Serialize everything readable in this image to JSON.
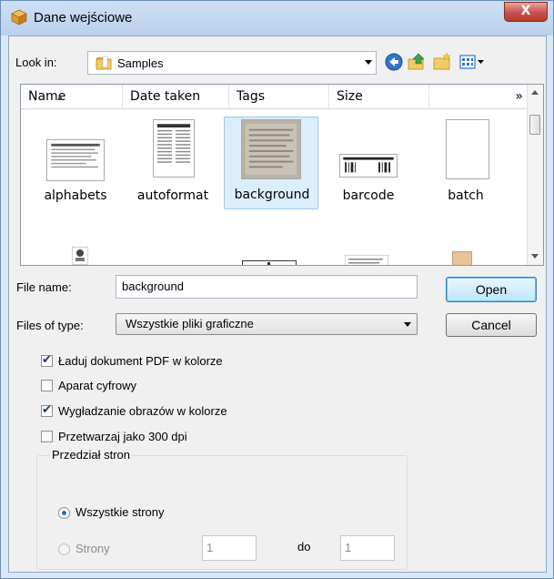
{
  "window": {
    "title": "Dane wejściowe",
    "close_glyph": "X"
  },
  "toolbar": {
    "look_in_label": "Look in:",
    "look_in_value": "Samples",
    "icons": [
      "back-icon",
      "up-folder-icon",
      "new-folder-icon",
      "view-menu-icon"
    ]
  },
  "columns": [
    "Name",
    "Date taken",
    "Tags",
    "Size",
    "»"
  ],
  "files": [
    {
      "name": "alphabets",
      "selected": false
    },
    {
      "name": "autoformat",
      "selected": false
    },
    {
      "name": "background",
      "selected": true
    },
    {
      "name": "barcode",
      "selected": false
    },
    {
      "name": "batch",
      "selected": false
    }
  ],
  "form": {
    "file_name_label": "File name:",
    "file_name_value": "background",
    "files_of_type_label": "Files of type:",
    "files_of_type_value": "Wszystkie pliki graficzne",
    "open_label": "Open",
    "cancel_label": "Cancel"
  },
  "options": [
    {
      "label": "Ładuj dokument PDF w kolorze",
      "checked": true
    },
    {
      "label": "Aparat cyfrowy",
      "checked": false
    },
    {
      "label": "Wygładzanie obrazów w kolorze",
      "checked": true
    },
    {
      "label": "Przetwarzaj jako 300 dpi",
      "checked": false
    }
  ],
  "page_range": {
    "title": "Przedział stron",
    "all_pages_label": "Wszystkie strony",
    "pages_label": "Strony",
    "from_value": "1",
    "to_label": "do",
    "to_value": "1"
  },
  "colors": {
    "accent": "#3c7fb1",
    "selection": "#dceefb"
  }
}
